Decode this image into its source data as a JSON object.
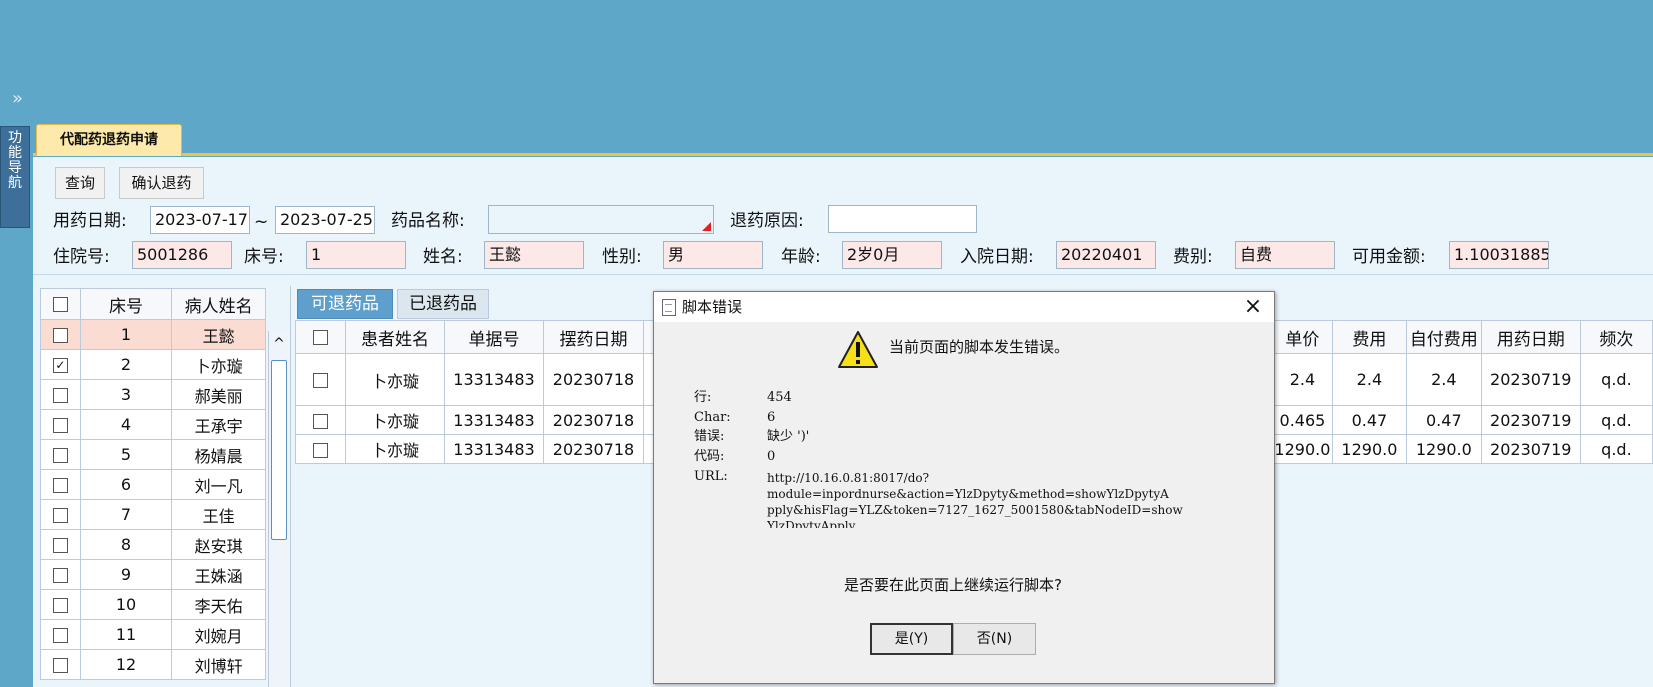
{
  "sidebar": {
    "nav_label": "功能导航"
  },
  "tab": {
    "title": "代配药退药申请"
  },
  "toolbar": {
    "query": "查询",
    "confirm_return": "确认退药"
  },
  "filters": {
    "date_label": "用药日期:",
    "date_from": "2023-07-17",
    "date_sep": "~",
    "date_to": "2023-07-25",
    "drug_name_label": "药品名称:",
    "drug_name_value": "",
    "reason_label": "退药原因:",
    "reason_value": ""
  },
  "patient_info": {
    "admission_no_label": "住院号:",
    "admission_no": "5001286",
    "bed_label": "床号:",
    "bed": "1",
    "name_label": "姓名:",
    "name": "王懿",
    "gender_label": "性别:",
    "gender": "男",
    "age_label": "年龄:",
    "age": "2岁0月",
    "admit_date_label": "入院日期:",
    "admit_date": "20220401",
    "fee_type_label": "费别:",
    "fee_type": "自费",
    "balance_label": "可用金额:",
    "balance": "1.10031885"
  },
  "patient_list": {
    "headers": {
      "bed": "床号",
      "name": "病人姓名"
    },
    "rows": [
      {
        "bed": "1",
        "name": "王懿",
        "checked": false,
        "selected": true
      },
      {
        "bed": "2",
        "name": "卜亦璇",
        "checked": true,
        "selected": false
      },
      {
        "bed": "3",
        "name": "郝美丽",
        "checked": false,
        "selected": false
      },
      {
        "bed": "4",
        "name": "王承宇",
        "checked": false,
        "selected": false
      },
      {
        "bed": "5",
        "name": "杨婧晨",
        "checked": false,
        "selected": false
      },
      {
        "bed": "6",
        "name": "刘一凡",
        "checked": false,
        "selected": false
      },
      {
        "bed": "7",
        "name": "王佳",
        "checked": false,
        "selected": false
      },
      {
        "bed": "8",
        "name": "赵安琪",
        "checked": false,
        "selected": false
      },
      {
        "bed": "9",
        "name": "王姝涵",
        "checked": false,
        "selected": false
      },
      {
        "bed": "10",
        "name": "李天佑",
        "checked": false,
        "selected": false
      },
      {
        "bed": "11",
        "name": "刘婉月",
        "checked": false,
        "selected": false
      },
      {
        "bed": "12",
        "name": "刘博轩",
        "checked": false,
        "selected": false
      }
    ]
  },
  "drug_tabs": {
    "returnable": "可退药品",
    "returned": "已退药品"
  },
  "drug_table": {
    "headers": {
      "patient_name": "患者姓名",
      "doc_no": "单据号",
      "dispense_date": "摆药日期"
    },
    "rows": [
      {
        "patient_name": "卜亦璇",
        "doc_no": "13313483",
        "dispense_date": "20230718"
      },
      {
        "patient_name": "卜亦璇",
        "doc_no": "13313483",
        "dispense_date": "20230718"
      },
      {
        "patient_name": "卜亦璇",
        "doc_no": "13313483",
        "dispense_date": "20230718"
      }
    ]
  },
  "price_table": {
    "headers": {
      "unit_price": "单价",
      "fee": "费用",
      "self_pay": "自付费用",
      "use_date": "用药日期",
      "frequency": "频次"
    },
    "rows": [
      {
        "unit_price": "2.4",
        "fee": "2.4",
        "self_pay": "2.4",
        "use_date": "20230719",
        "frequency": "q.d."
      },
      {
        "unit_price": "0.465",
        "fee": "0.47",
        "self_pay": "0.47",
        "use_date": "20230719",
        "frequency": "q.d."
      },
      {
        "unit_price": "1290.0",
        "fee": "1290.0",
        "self_pay": "1290.0",
        "use_date": "20230719",
        "frequency": "q.d."
      }
    ]
  },
  "dialog": {
    "title": "脚本错误",
    "message": "当前页面的脚本发生错误。",
    "line_label": "行:",
    "line_value": "454",
    "char_label": "Char:",
    "char_value": "6",
    "error_label": "错误:",
    "error_value": "缺少 ')'",
    "code_label": "代码:",
    "code_value": "0",
    "url_label": "URL:",
    "url_value": "http://10.16.0.81:8017/do?\nmodule=inpordnurse&action=YlzDpyty&method=showYlzDpytyA\npply&hisFlag=YLZ&token=7127_1627_5001580&tabNodeID=show\nYlzDpytyApply",
    "question": "是否要在此页面上继续运行脚本?",
    "yes_label": "是(Y)",
    "no_label": "否(N)"
  }
}
